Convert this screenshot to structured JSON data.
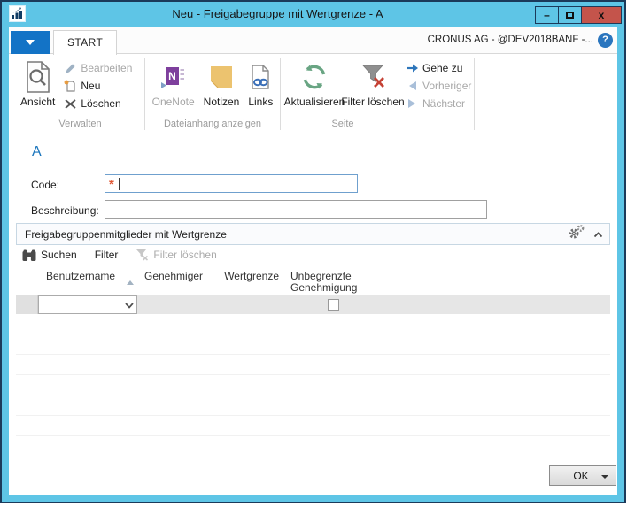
{
  "window": {
    "title": "Neu - Freigabegruppe mit Wertgrenze - A",
    "minimize_glyph": "–",
    "close_glyph": "x"
  },
  "tab_bar": {
    "active_tab": "START",
    "company": "CRONUS AG - @DEV2018BANF -...",
    "help_glyph": "?"
  },
  "ribbon": {
    "verwalten": {
      "label": "Verwalten",
      "ansicht": "Ansicht",
      "bearbeiten": "Bearbeiten",
      "neu": "Neu",
      "loeschen": "Löschen"
    },
    "dateianhang": {
      "label": "Dateianhang anzeigen",
      "onenote": "OneNote",
      "notizen": "Notizen",
      "links": "Links"
    },
    "seite": {
      "label": "Seite",
      "aktualisieren": "Aktualisieren",
      "filter_loeschen": "Filter löschen",
      "gehe_zu": "Gehe zu",
      "vorheriger": "Vorheriger",
      "naechster": "Nächster"
    }
  },
  "form": {
    "heading": "A",
    "code_label": "Code:",
    "code_value": "",
    "required_marker": "*",
    "beschreibung_label": "Beschreibung:",
    "beschreibung_value": ""
  },
  "subform": {
    "title": "Freigabegruppenmitglieder mit Wertgrenze",
    "toolbar": {
      "suchen": "Suchen",
      "filter": "Filter",
      "filter_loeschen": "Filter löschen"
    },
    "columns": [
      "Benutzername",
      "Genehmiger",
      "Wertgrenze",
      "Unbegrenzte Genehmigung"
    ],
    "sort_column": "Benutzername",
    "sort_direction": "ascending",
    "rows": [
      {
        "benutzername": "",
        "genehmiger": "",
        "wertgrenze": "",
        "unbegrenzte_genehmigung": false
      }
    ],
    "empty_row_count": 6
  },
  "footer": {
    "ok": "OK"
  },
  "colors": {
    "chrome": "#5ec5e6",
    "frame": "#1b3a5a",
    "close_button": "#c4544b",
    "app_menu": "#1373c6",
    "accent_heading": "#1b75bc",
    "required_asterisk": "#e0532f",
    "refresh_green": "#69a583",
    "onenote_purple": "#7e3f9d",
    "notes_yellow": "#ecc36f",
    "links_blue": "#3a6fb8",
    "goto_blue": "#2e76bb"
  }
}
